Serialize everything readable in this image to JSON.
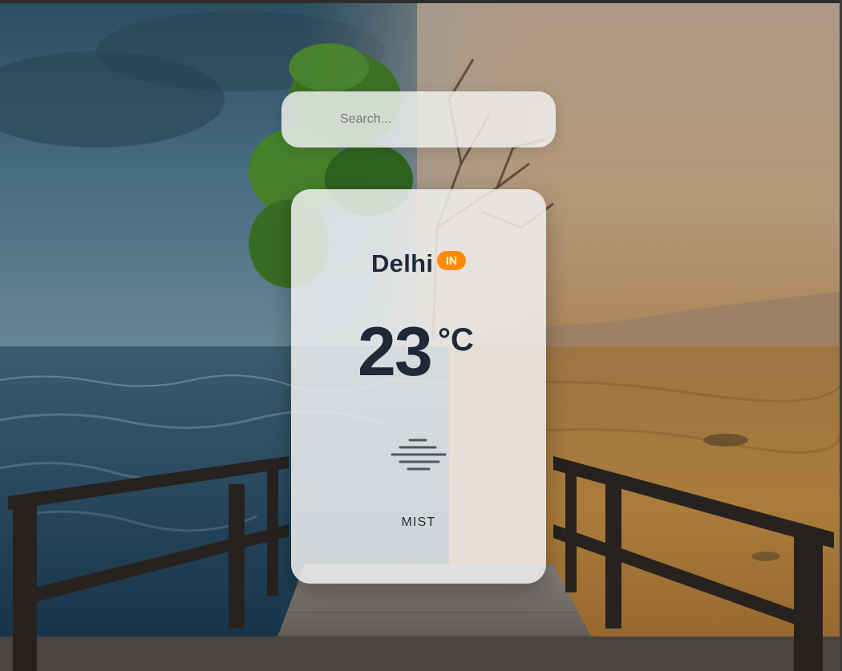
{
  "search": {
    "placeholder": "Search..."
  },
  "weather": {
    "city": "Delhi",
    "country_code": "IN",
    "temperature": "23",
    "unit": "°C",
    "condition": "MIST",
    "condition_icon": "mist-icon"
  },
  "colors": {
    "text_dark": "#1f2a37",
    "badge_orange": "#ff8c00",
    "card_background": "#f0f0f0"
  }
}
